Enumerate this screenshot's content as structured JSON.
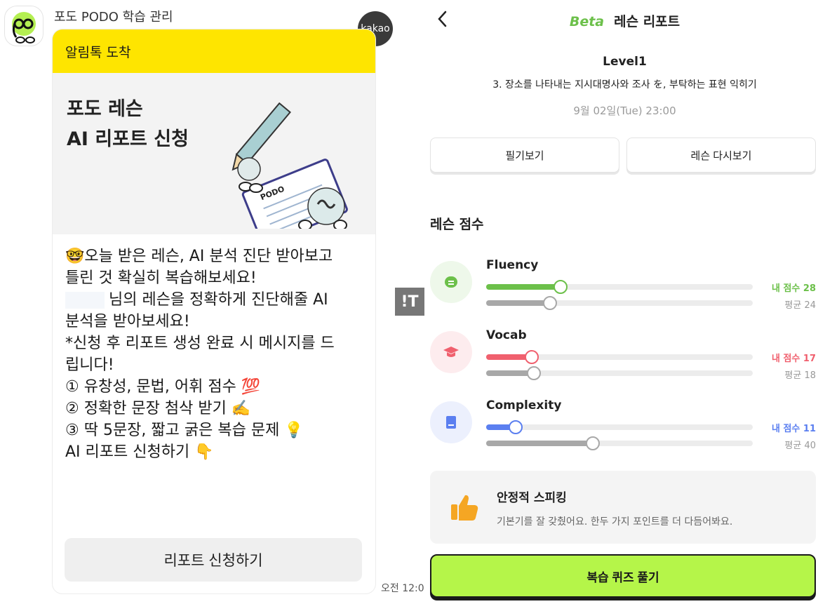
{
  "kakao": {
    "sender": "포도 PODO 학습 관리",
    "badge": "kakao",
    "bubble_header": "알림톡 도착",
    "hero_title_line1": "포도 레슨",
    "hero_title_line2": "AI 리포트 신청",
    "hero_illus_text": "PODO",
    "message_lines": [
      "🤓오늘 받은 레슨, AI 분석 진단 받아보고",
      "틀린 것 확실히 복습해보세요!",
      "",
      "님의 레슨을 정확하게 진단해줄 AI",
      "분석을 받아보세요!",
      "*신청 후 리포트 생성 완료 시 메시지를 드",
      "립니다!",
      "",
      "① 유창성, 문법, 어휘 점수 💯",
      "② 정확한 문장 첨삭 받기 ✍️",
      "③ 딱 5문장, 짧고 굵은 복습 문제 💡",
      "",
      "AI 리포트 신청하기 👇"
    ],
    "report_button": "리포트 신청하기",
    "timestamp": "오전 12:0"
  },
  "marker": {
    "label": "!T"
  },
  "report": {
    "beta": "Beta",
    "title": "레슨 리포트",
    "level": "Level1",
    "lesson_title": "3. 장소를 나타내는 지시대명사와 조사 を, 부탁하는 표현 익히기",
    "lesson_date": "9월 02일(Tue) 23:00",
    "tabs": [
      "필기보기",
      "레슨 다시보기"
    ],
    "section_title": "레슨 점수",
    "metrics": [
      {
        "name": "Fluency",
        "my_label": "내 점수 28",
        "avg_label": "평균 24",
        "my": 28,
        "avg": 24,
        "color": "#6cc04a",
        "bg": "#eef8ea",
        "icon": "chat-icon"
      },
      {
        "name": "Vocab",
        "my_label": "내 점수 17",
        "avg_label": "평균 18",
        "my": 17,
        "avg": 18,
        "color": "#f0606e",
        "bg": "#fdecee",
        "icon": "graduation-cap-icon"
      },
      {
        "name": "Complexity",
        "my_label": "내 점수 11",
        "avg_label": "평균 40",
        "my": 11,
        "avg": 40,
        "color": "#5b7ff0",
        "bg": "#ecf0fd",
        "icon": "book-icon"
      }
    ],
    "score_max": 100,
    "feedback_title": "안정적 스피킹",
    "feedback_desc": "기본기를 잘 갖췄어요. 한두 가지 포인트를 더 다듬어봐요.",
    "feedback_icon": "thumbs-up-icon",
    "quiz_button": "복습 퀴즈 풀기"
  }
}
